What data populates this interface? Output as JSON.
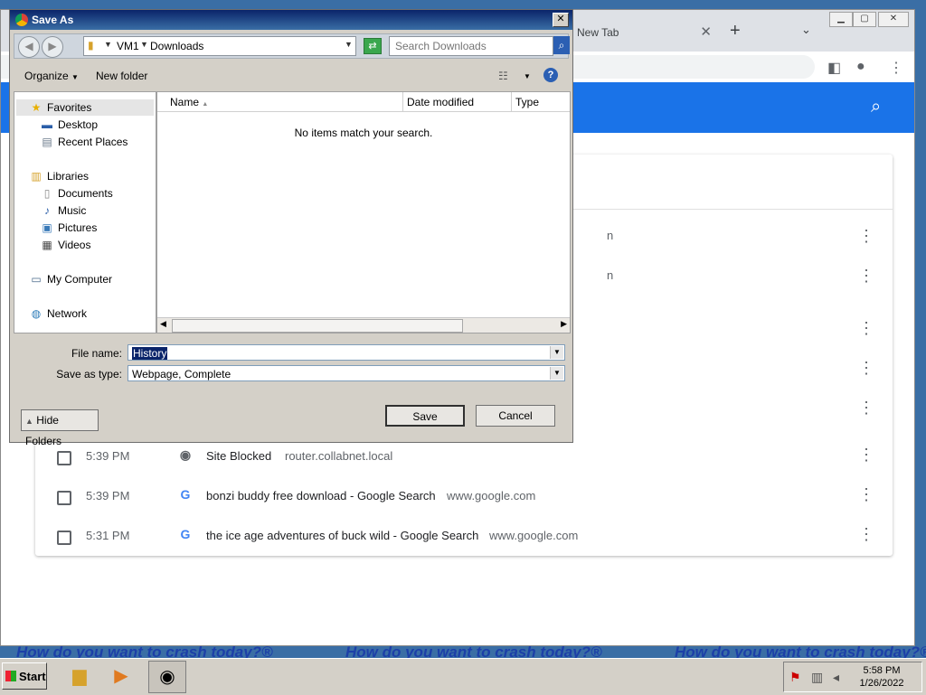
{
  "desktop": {
    "banner_text": "How do you want to crash today?®"
  },
  "chrome": {
    "tab_title": "New Tab",
    "tab_close": "✕",
    "new_tab": "+",
    "tab_search": "⌄",
    "history_rows": [
      {
        "time": "5:39 PM",
        "favicon": "site-blocked-icon",
        "title": "Site Blocked",
        "domain": "router.collabnet.local"
      },
      {
        "time": "5:39 PM",
        "favicon": "google-icon",
        "title": "bonzi buddy free download - Google Search",
        "domain": "www.google.com"
      },
      {
        "time": "5:31 PM",
        "favicon": "google-icon",
        "title": "the ice age adventures of buck wild - Google Search",
        "domain": "www.google.com"
      }
    ]
  },
  "dialog": {
    "title": "Save As",
    "close": "✕",
    "breadcrumb": [
      "VM1",
      "Downloads"
    ],
    "search_placeholder": "Search Downloads",
    "toolbar": {
      "organize": "Organize",
      "new_folder": "New folder"
    },
    "nav": {
      "favorites": "Favorites",
      "desktop": "Desktop",
      "recent": "Recent Places",
      "libraries": "Libraries",
      "documents": "Documents",
      "music": "Music",
      "pictures": "Pictures",
      "videos": "Videos",
      "computer": "My Computer",
      "network": "Network"
    },
    "columns": {
      "name": "Name",
      "date": "Date modified",
      "type": "Type"
    },
    "empty_message": "No items match your search.",
    "file_name_label": "File name:",
    "file_name_value": "History",
    "save_type_label": "Save as type:",
    "save_type_value": "Webpage, Complete",
    "hide_folders": "Hide Folders",
    "save": "Save",
    "cancel": "Cancel"
  },
  "taskbar": {
    "start": "Start",
    "time": "5:58 PM",
    "date": "1/26/2022"
  }
}
